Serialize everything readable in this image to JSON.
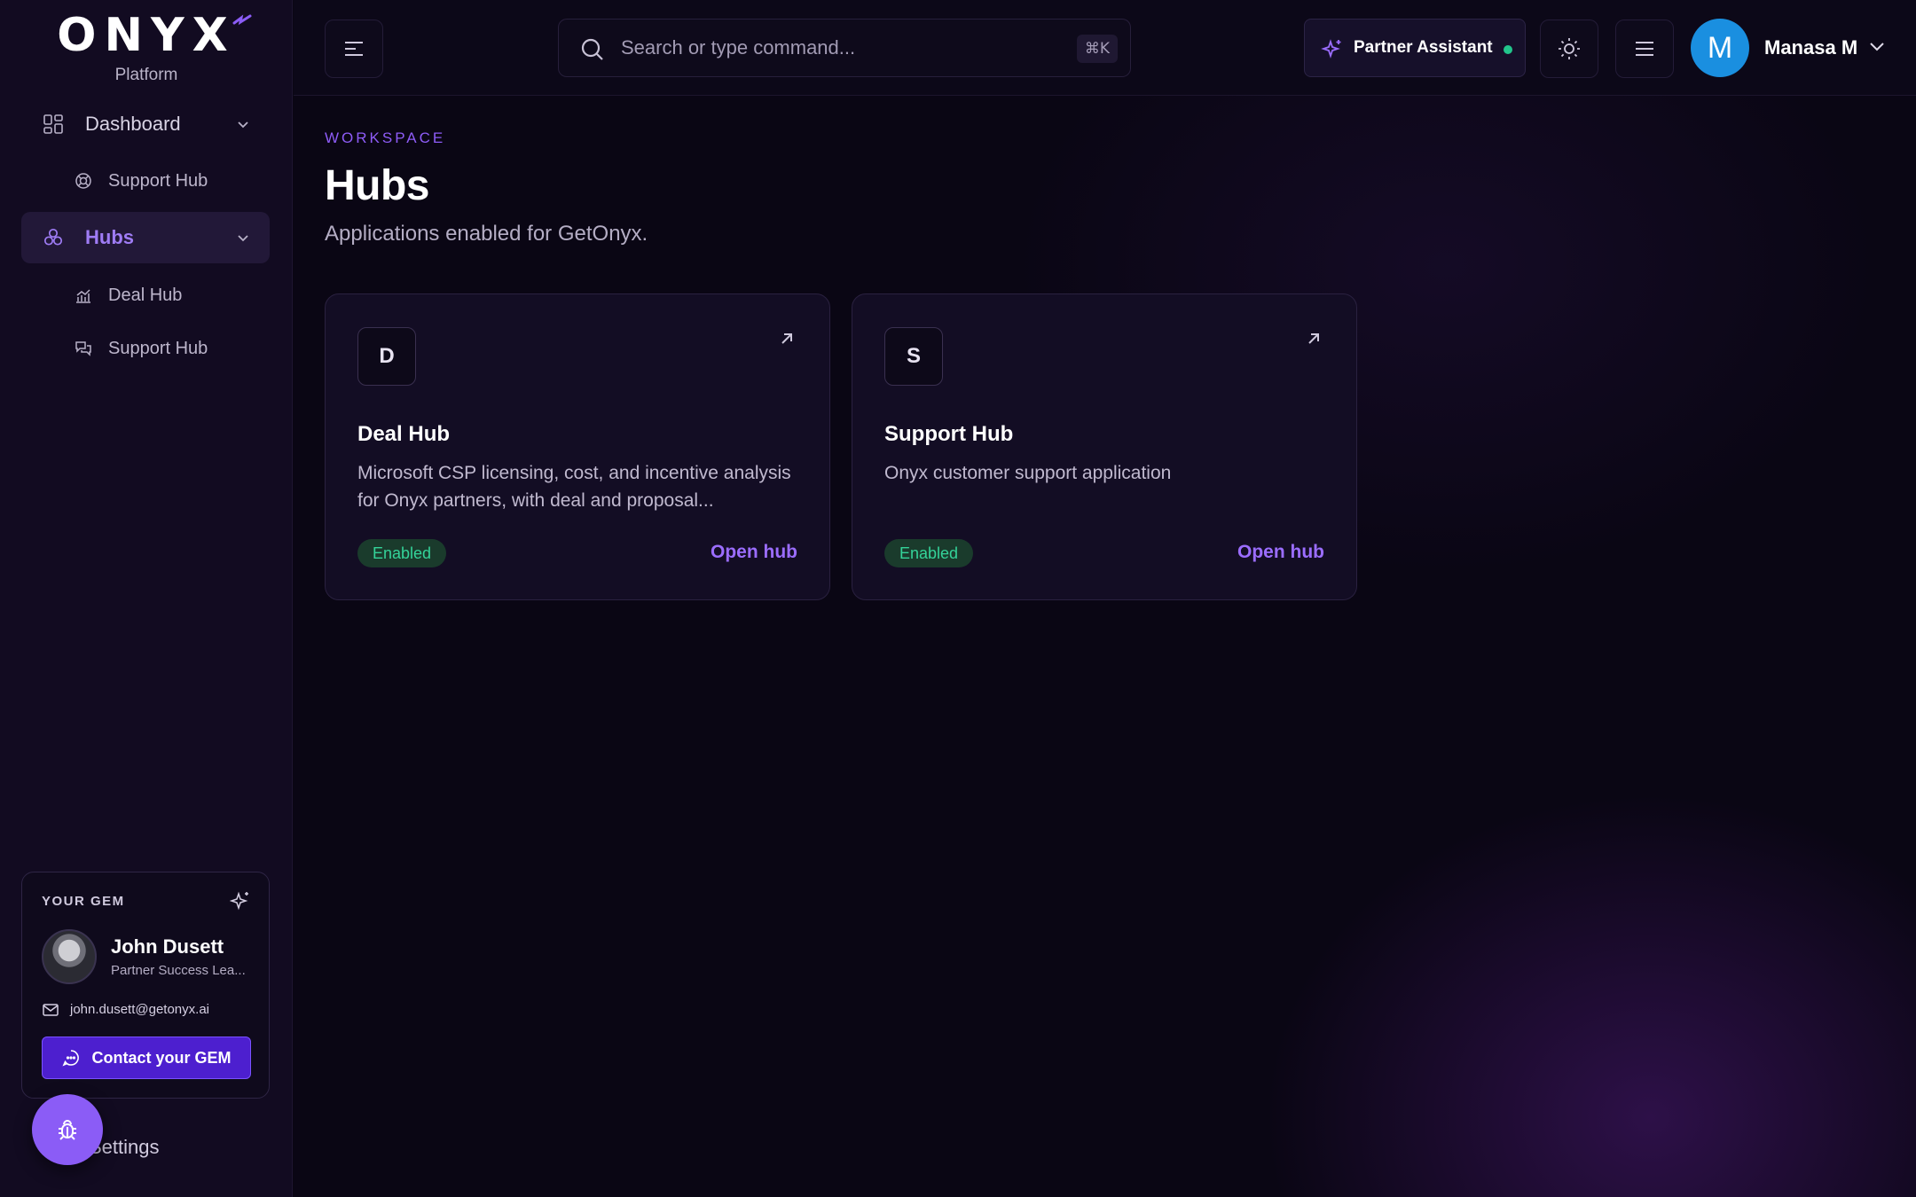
{
  "brand": {
    "name": "ONYX",
    "subtitle": "Platform"
  },
  "sidebar": {
    "items": [
      {
        "label": "Dashboard",
        "icon": "grid-icon",
        "expanded": true
      },
      {
        "label": "Support Hub",
        "icon": "lifebuoy-icon"
      },
      {
        "label": "Hubs",
        "icon": "hubs-icon",
        "active": true,
        "expanded": true
      },
      {
        "label": "Deal Hub",
        "icon": "chart-icon"
      },
      {
        "label": "Support Hub",
        "icon": "chat-icon"
      }
    ],
    "settings_label": "Settings"
  },
  "gem": {
    "header": "YOUR GEM",
    "name": "John Dusett",
    "role": "Partner Success Lea...",
    "email": "john.dusett@getonyx.ai",
    "contact_label": "Contact your GEM"
  },
  "topbar": {
    "search_placeholder": "Search or type command...",
    "shortcut": "⌘K",
    "assistant_label": "Partner Assistant",
    "user_initial": "M",
    "user_name": "Manasa M"
  },
  "page": {
    "eyebrow": "WORKSPACE",
    "title": "Hubs",
    "subtitle": "Applications enabled for GetOnyx."
  },
  "hubs": [
    {
      "letter": "D",
      "title": "Deal Hub",
      "description": "Microsoft CSP licensing, cost, and incentive analysis for Onyx partners, with deal and proposal...",
      "status": "Enabled",
      "action": "Open hub"
    },
    {
      "letter": "S",
      "title": "Support Hub",
      "description": "Onyx customer support application",
      "status": "Enabled",
      "action": "Open hub"
    }
  ],
  "colors": {
    "accent": "#8b5cf6",
    "enabled": "#34d399",
    "avatar": "#1a8fe0",
    "background": "#0a0614"
  }
}
